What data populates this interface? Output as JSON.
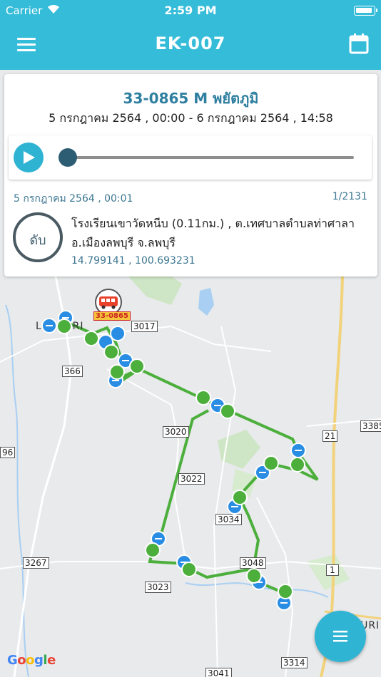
{
  "status_bar": {
    "carrier": "Carrier",
    "time": "2:59 PM"
  },
  "header": {
    "title": "EK-007",
    "menu_icon": "hamburger-icon",
    "calendar_icon": "calendar-icon"
  },
  "vehicle": {
    "plate": "33-0865 M พยัตภูมิ",
    "range": "5 กรกฎาคม 2564 , 00:00 - 6 กรกฎาคม 2564 , 14:58",
    "marker_label": "33-0865"
  },
  "player": {
    "play_icon": "play-icon",
    "progress": 0.0
  },
  "point": {
    "timestamp": "5 กรกฎาคม 2564 , 00:01",
    "counter": "1/2131",
    "status": "ดับ",
    "address": "โรงเรียนเขาวัดหนีบ (0.11กม.) , ต.เทศบาลตำบลท่าศาลา อ.เมืองลพบุรี จ.ลพบุรี",
    "coords": "14.799141 , 100.693231"
  },
  "map": {
    "road_labels": [
      "3017",
      "366",
      "3020",
      "3022",
      "3034",
      "3048",
      "3023",
      "3267",
      "21",
      "3385",
      "1",
      "3314",
      "3041",
      "96"
    ],
    "place_labels": [
      "LOPBURI",
      "SARABURI"
    ],
    "attribution": [
      "G",
      "o",
      "o",
      "g",
      "l",
      "e"
    ]
  },
  "fab_icon": "list-icon",
  "colors": {
    "primary": "#35bcd9",
    "route": "#4caf3c",
    "stop_marker": "#2a8de4"
  }
}
